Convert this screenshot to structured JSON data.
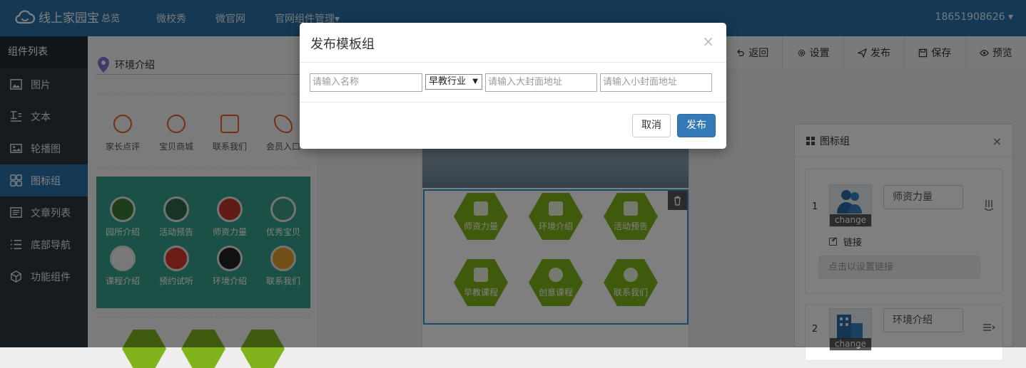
{
  "header": {
    "brand": "线上家园宝",
    "overview": "总览",
    "nav": [
      "微校秀",
      "微官网",
      "官网组件管理▾"
    ],
    "user": "18651908626 ▾"
  },
  "sidebar": {
    "title": "组件列表",
    "items": [
      {
        "label": "图片",
        "icon": "image-icon"
      },
      {
        "label": "文本",
        "icon": "text-icon"
      },
      {
        "label": "轮播图",
        "icon": "carousel-icon"
      },
      {
        "label": "图标组",
        "icon": "grid-icon",
        "active": true
      },
      {
        "label": "文章列表",
        "icon": "article-list-icon"
      },
      {
        "label": "底部导航",
        "icon": "list-icon"
      },
      {
        "label": "功能组件",
        "icon": "cube-icon"
      }
    ]
  },
  "palette": {
    "title": "环境介绍",
    "quick_items": [
      "家长点评",
      "宝贝商城",
      "联系我们",
      "会员入口"
    ],
    "teal_items": [
      "园所介绍",
      "活动预告",
      "师资力量",
      "优秀宝贝",
      "课程介绍",
      "预约试听",
      "环境介绍",
      "联系我们"
    ]
  },
  "toolbar": {
    "back": "返回",
    "settings": "设置",
    "publish": "发布",
    "save": "保存",
    "preview": "预览"
  },
  "preview_icons": [
    "师资力量",
    "环境介绍",
    "活动预告",
    "早教课程",
    "创意课程",
    "联系我们"
  ],
  "props_panel": {
    "title": "图标组",
    "close": "×",
    "items": [
      {
        "index": "1",
        "name": "师资力量",
        "change": "change",
        "link_label": "链接",
        "link_placeholder": "点击以设置链接"
      },
      {
        "index": "2",
        "name": "环境介绍",
        "change": "change"
      }
    ]
  },
  "modal": {
    "title": "发布模板组",
    "close": "×",
    "name_placeholder": "请输入名称",
    "industry": "早教行业",
    "big_cover_placeholder": "请输入大封面地址",
    "small_cover_placeholder": "请输入小封面地址",
    "cancel": "取消",
    "publish": "发布"
  },
  "colors": {
    "header": "#2a72a8",
    "sidebar": "#2c3640",
    "teal": "#37a08c",
    "hex": "#80b41a",
    "primary": "#337ab7"
  }
}
